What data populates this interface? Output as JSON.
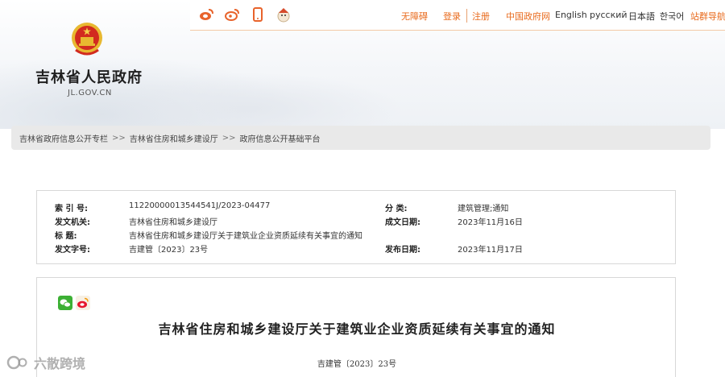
{
  "top_nav": {
    "accessibility": "无障碍",
    "login": "登录",
    "register": "注册",
    "china_gov": "中国政府网",
    "english": "English",
    "russian": "русский",
    "japanese": "日本語",
    "korean": "한국어",
    "site_nav": "站群导航"
  },
  "social_icons": [
    "weibo-icon",
    "weibo-alt-icon",
    "mobile-icon",
    "mascot-icon"
  ],
  "site": {
    "title": "吉林省人民政府",
    "domain": "JL.GOV.CN"
  },
  "breadcrumb": {
    "items": [
      "吉林省政府信息公开专栏",
      "吉林省住房和城乡建设厅",
      "政府信息公开基础平台"
    ],
    "separator": ">>"
  },
  "info": {
    "index_label": "索 引 号:",
    "index_value": "11220000013544541J/2023-04477",
    "category_label": "分 类:",
    "category_value": "建筑管理;通知",
    "issuer_label": "发文机关:",
    "issuer_value": "吉林省住房和城乡建设厅",
    "date_label": "成文日期:",
    "date_value": "2023年11月16日",
    "subject_label": "标 题:",
    "subject_value": "吉林省住房和城乡建设厅关于建筑业企业资质延续有关事宜的通知",
    "docno_label": "发文字号:",
    "docno_value": "吉建管〔2023〕23号",
    "publish_label": "发布日期:",
    "publish_value": "2023年11月17日"
  },
  "article": {
    "title": "吉林省住房和城乡建设厅关于建筑业企业资质延续有关事宜的通知",
    "doc_number": "吉建管〔2023〕23号"
  },
  "watermark": {
    "text": "六散跨境"
  },
  "colors": {
    "accent": "#e86a1c",
    "wechat": "#3cb034",
    "weibo": "#e6162d"
  }
}
